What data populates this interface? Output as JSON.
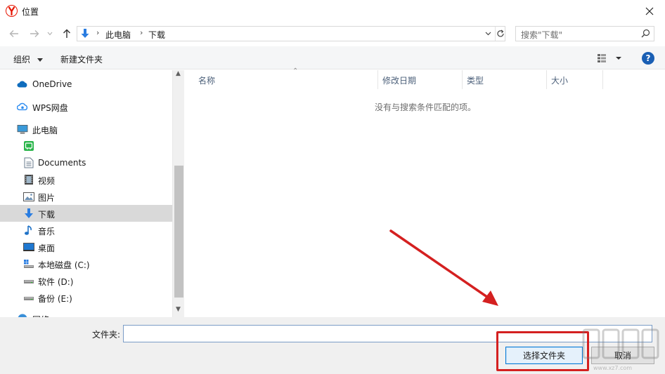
{
  "window": {
    "title": "位置",
    "close_glyph": "✕"
  },
  "navigation": {
    "back_icon": "arrow-left-icon",
    "forward_icon": "arrow-right-icon",
    "up_icon": "arrow-up-icon"
  },
  "address": {
    "segments": [
      "此电脑",
      "下载"
    ],
    "separator": "›"
  },
  "search": {
    "placeholder": "搜索\"下载\""
  },
  "toolbar": {
    "organize_label": "组织",
    "new_folder_label": "新建文件夹",
    "help_label": "?"
  },
  "sidebar": {
    "items": [
      {
        "label": "OneDrive",
        "icon": "cloud-icon"
      },
      {
        "label": "WPS网盘",
        "icon": "wps-cloud-icon"
      },
      {
        "label": "此电脑",
        "icon": "computer-icon"
      },
      {
        "label": "",
        "icon": "wechat-folder-icon"
      },
      {
        "label": "Documents",
        "icon": "document-icon"
      },
      {
        "label": "视频",
        "icon": "video-icon"
      },
      {
        "label": "图片",
        "icon": "picture-icon"
      },
      {
        "label": "下载",
        "icon": "download-icon",
        "selected": true
      },
      {
        "label": "音乐",
        "icon": "music-icon"
      },
      {
        "label": "桌面",
        "icon": "desktop-icon"
      },
      {
        "label": "本地磁盘 (C:)",
        "icon": "system-drive-icon"
      },
      {
        "label": "软件 (D:)",
        "icon": "drive-icon"
      },
      {
        "label": "备份 (E:)",
        "icon": "drive-icon"
      },
      {
        "label": "网络",
        "icon": "network-icon"
      }
    ]
  },
  "file_list": {
    "columns": [
      "名称",
      "修改日期",
      "类型",
      "大小"
    ],
    "empty_message": "没有与搜索条件匹配的项。"
  },
  "footer": {
    "folder_label": "文件夹:",
    "folder_value": "",
    "select_button_label": "选择文件夹",
    "cancel_button_label": "取消"
  },
  "colors": {
    "accent": "#0078d7",
    "annotation_red": "#d42020",
    "selected_item_bg": "#d9d9d9"
  }
}
